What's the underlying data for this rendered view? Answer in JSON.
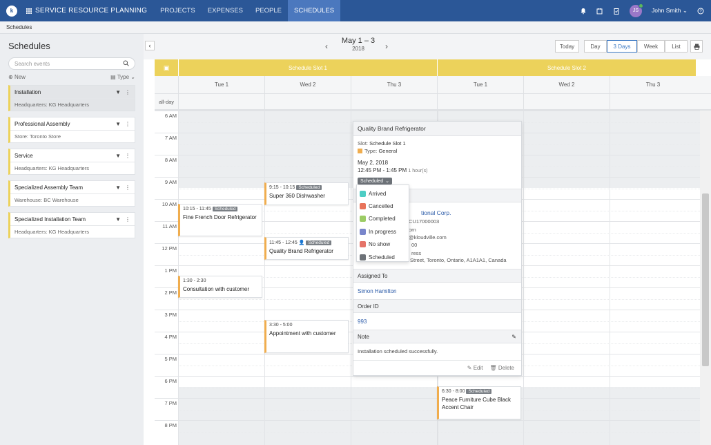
{
  "nav": {
    "logo": "k",
    "app_title": "SERVICE RESOURCE PLANNING",
    "links": [
      "PROJECTS",
      "EXPENSES",
      "PEOPLE",
      "SCHEDULES"
    ],
    "active": "SCHEDULES",
    "user_initials": "JS",
    "user_name": "John Smith"
  },
  "breadcrumb": "Schedules",
  "sidebar": {
    "title": "Schedules",
    "search_placeholder": "Search events",
    "new_label": "New",
    "type_label": "Type",
    "items": [
      {
        "name": "Installation",
        "location": "Headquarters: KG Headquarters"
      },
      {
        "name": "Professional Assembly",
        "location": "Store: Toronto Store"
      },
      {
        "name": "Service",
        "location": "Headquarters: KG Headquarters"
      },
      {
        "name": "Specialized Assembly Team",
        "location": "Warehouse: BC Warehouse"
      },
      {
        "name": "Specialized Installation Team",
        "location": "Headquarters: KG Headquarters"
      }
    ]
  },
  "toolbar": {
    "range": "May 1 – 3",
    "year": "2018",
    "today": "Today",
    "views": [
      "Day",
      "3 Days",
      "Week",
      "List"
    ],
    "active_view": "3 Days"
  },
  "slots": [
    "Schedule Slot 1",
    "Schedule Slot 2"
  ],
  "days": [
    "Tue 1",
    "Wed 2",
    "Thu 3",
    "Tue 1",
    "Wed 2",
    "Thu 3"
  ],
  "allday_label": "all-day",
  "hours": [
    "6 AM",
    "7 AM",
    "8 AM",
    "9 AM",
    "10 AM",
    "11 AM",
    "12 PM",
    "1 PM",
    "2 PM",
    "3 PM",
    "4 PM",
    "5 PM",
    "6 PM",
    "7 PM",
    "8 PM"
  ],
  "events": [
    {
      "time": "10:15 - 11:45",
      "badge": "Scheduled",
      "title": "Fine French Door Refrigerator"
    },
    {
      "time": "9:15 - 10:15",
      "badge": "Scheduled",
      "title": "Super 360 Dishwasher"
    },
    {
      "time": "11:45 - 12:45",
      "badge": "Scheduled",
      "title": "Quality Brand Refrigerator"
    },
    {
      "time": "1:30 - 2:30",
      "badge": "",
      "title": "Consultation with customer"
    },
    {
      "time": "3:30 - 5:00",
      "badge": "",
      "title": "Appointment with customer"
    },
    {
      "time": "6:30 - 8:00",
      "badge": "Scheduled",
      "title": "Peace Furniture Cube Black Accent Chair"
    }
  ],
  "popover": {
    "title": "Quality Brand Refrigerator",
    "slot_label": "Slot:",
    "slot_value": "Schedule Slot 1",
    "type_label": "Type:",
    "type_value": "General",
    "date": "May 2, 2018",
    "time": "12:45 PM - 1:45 PM",
    "duration": "1 hour(s)",
    "status": "Scheduled",
    "customer_name": "tional Corp.",
    "customer_id": "CU17000003",
    "customer_contact": "orn",
    "customer_email": "@kloudville.com",
    "customer_phone": "00",
    "customer_addr_label": "ress",
    "customer_address": "Street, Toronto, Ontario, A1A1A1, Canada",
    "assigned_label": "Assigned To",
    "assigned_value": "Simon Hamilton",
    "order_label": "Order ID",
    "order_value": "993",
    "note_label": "Note",
    "note_value": "Installation scheduled successfully.",
    "edit": "Edit",
    "delete": "Delete"
  },
  "status_options": [
    {
      "label": "Arrived",
      "color": "#4ecdc4"
    },
    {
      "label": "Cancelled",
      "color": "#e8735a"
    },
    {
      "label": "Completed",
      "color": "#9ccc65"
    },
    {
      "label": "In progress",
      "color": "#7986cb"
    },
    {
      "label": "No show",
      "color": "#e57368"
    },
    {
      "label": "Scheduled",
      "color": "#6d7278"
    }
  ],
  "colors": {
    "nav": "#2b5797",
    "slot": "#ecd25b",
    "event_accent": "#f0ad4e",
    "link": "#2a5aa8"
  }
}
